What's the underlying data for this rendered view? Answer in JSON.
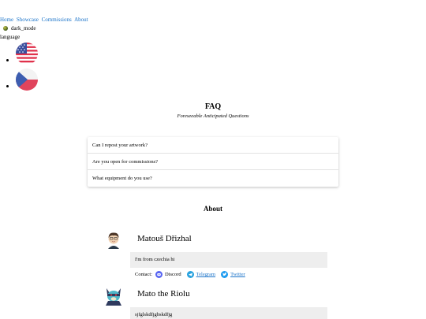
{
  "nav": {
    "links": [
      "Home",
      "Showcase",
      "Commissions",
      "About"
    ]
  },
  "dark_mode": {
    "label": "dark_mode",
    "icon": "moon-icon"
  },
  "language": {
    "label": "language",
    "options": [
      {
        "flag": "us-flag-icon"
      },
      {
        "flag": "czech-flag-icon"
      }
    ]
  },
  "faq": {
    "title": "FAQ",
    "subtitle": "Foreseeable Anticipated Questions",
    "questions": [
      "Can I repost your artwork?",
      "Are you open for commissions?",
      "What equipment do you use?"
    ]
  },
  "about": {
    "title": "About",
    "people": [
      {
        "name": "Matouš Dřizhal",
        "bio": "I'm from czechia hi",
        "contact_label": "Contact:",
        "contacts": [
          {
            "icon": "discord-icon",
            "label": "Discord"
          },
          {
            "icon": "telegram-icon",
            "label": "Telegram"
          },
          {
            "icon": "twitter-icon",
            "label": "Twitter"
          }
        ]
      },
      {
        "name": "Mato the Riolu",
        "bio": "sjfglskdfjgbskdfjg"
      }
    ]
  },
  "colors": {
    "link": "#1a73c9",
    "bio_bg": "#eeeeee",
    "discord": "#5865f2",
    "telegram": "#2aa3df"
  }
}
